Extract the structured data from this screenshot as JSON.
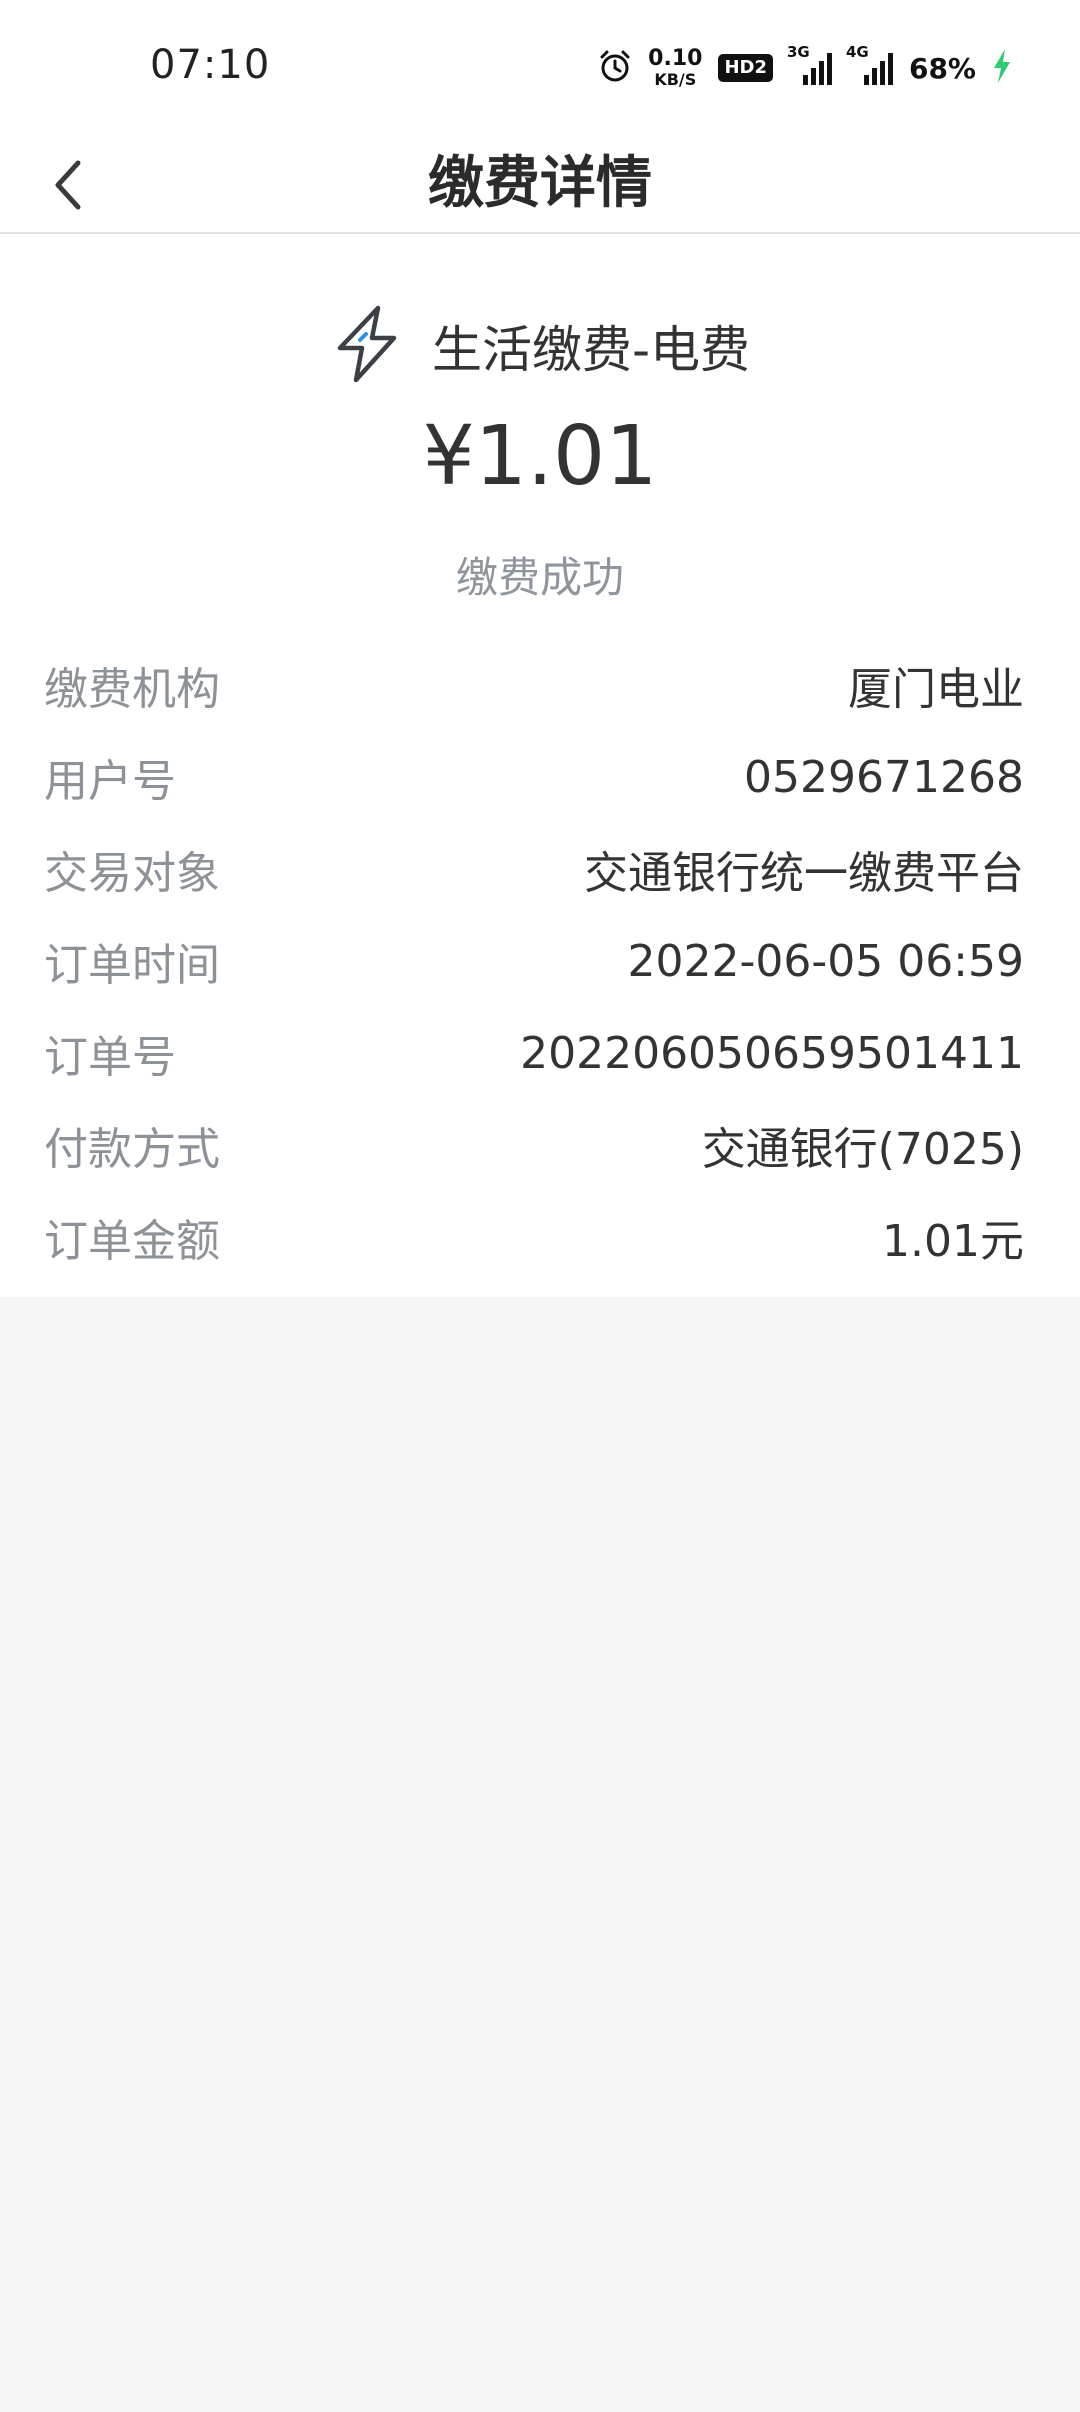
{
  "status_bar": {
    "time": "07:10",
    "net_speed_value": "0.10",
    "net_speed_unit": "KB/S",
    "hd_badge": "HD2",
    "signal1_label": "3G",
    "signal2_label": "4G",
    "battery": "68%",
    "charging_color": "#2ecc71"
  },
  "header": {
    "title": "缴费详情"
  },
  "payment": {
    "business": "生活缴费-电费",
    "amount": "¥1.01",
    "status": "缴费成功",
    "rows": [
      {
        "label": "缴费机构",
        "value": "厦门电业"
      },
      {
        "label": "用户号",
        "value": "0529671268"
      },
      {
        "label": "交易对象",
        "value": "交通银行统一缴费平台"
      },
      {
        "label": "订单时间",
        "value": "2022-06-05 06:59"
      },
      {
        "label": "订单号",
        "value": "202206050659501411"
      },
      {
        "label": "付款方式",
        "value": "交通银行(7025)"
      },
      {
        "label": "订单金额",
        "value": "1.01元"
      }
    ]
  },
  "colors": {
    "accent_blue": "#2f8fe8",
    "label_gray": "#8c9298",
    "background": "#f5f5f5"
  }
}
